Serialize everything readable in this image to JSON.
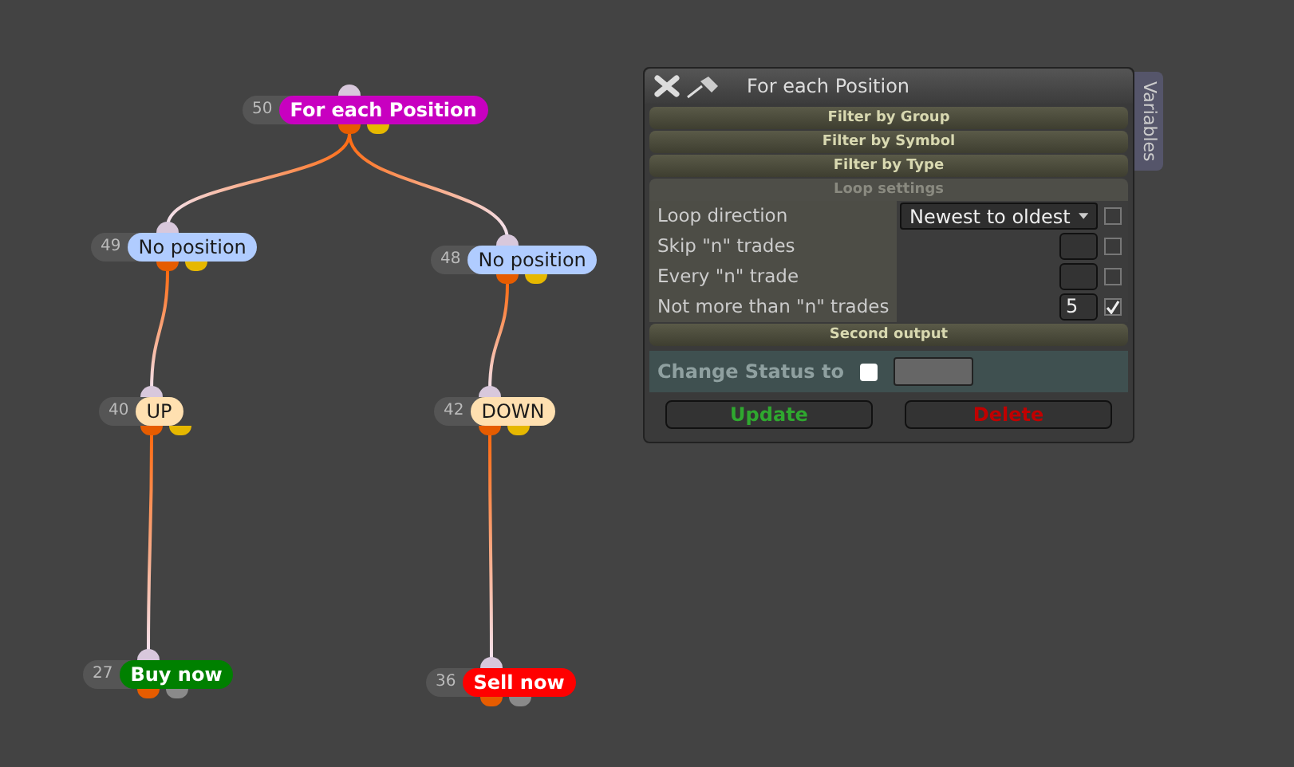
{
  "canvas": {
    "nodes": [
      {
        "number": "50",
        "label": "For each Position",
        "kind": "loop",
        "color": "#c800c0",
        "children": [
          {
            "number": "49",
            "label": "No position",
            "kind": "condition",
            "color": "#b0ccff",
            "children": [
              {
                "number": "40",
                "label": "UP",
                "kind": "condition",
                "color": "#ffe0b0",
                "children": [
                  {
                    "number": "27",
                    "label": "Buy now",
                    "kind": "action",
                    "color": "#008000"
                  }
                ]
              }
            ]
          },
          {
            "number": "48",
            "label": "No position",
            "kind": "condition",
            "color": "#b0ccff",
            "children": [
              {
                "number": "42",
                "label": "DOWN",
                "kind": "condition",
                "color": "#ffe0b0",
                "children": [
                  {
                    "number": "36",
                    "label": "Sell now",
                    "kind": "action",
                    "color": "#ff0000"
                  }
                ]
              }
            ]
          }
        ]
      }
    ]
  },
  "panel": {
    "title": "For each Position",
    "side_tab": "Variables",
    "sections": [
      {
        "title": "Filter by Group",
        "expanded": false
      },
      {
        "title": "Filter by Symbol",
        "expanded": false
      },
      {
        "title": "Filter by Type",
        "expanded": false
      },
      {
        "title": "Loop settings",
        "expanded": true,
        "rows": [
          {
            "label": "Loop direction",
            "kind": "select",
            "value": "Newest to oldest",
            "checked": false
          },
          {
            "label": "Skip \"n\" trades",
            "kind": "number",
            "checked": false
          },
          {
            "label": "Every \"n\" trade",
            "kind": "number",
            "checked": false
          },
          {
            "label": "Not more than \"n\" trades",
            "kind": "number",
            "value": "5",
            "checked": true
          }
        ]
      },
      {
        "title": "Second output",
        "expanded": false
      }
    ],
    "change_status": {
      "label": "Change Status to",
      "checked": false
    },
    "buttons": [
      {
        "label": "Update",
        "kind": "update"
      },
      {
        "label": "Delete",
        "kind": "delete"
      }
    ]
  }
}
